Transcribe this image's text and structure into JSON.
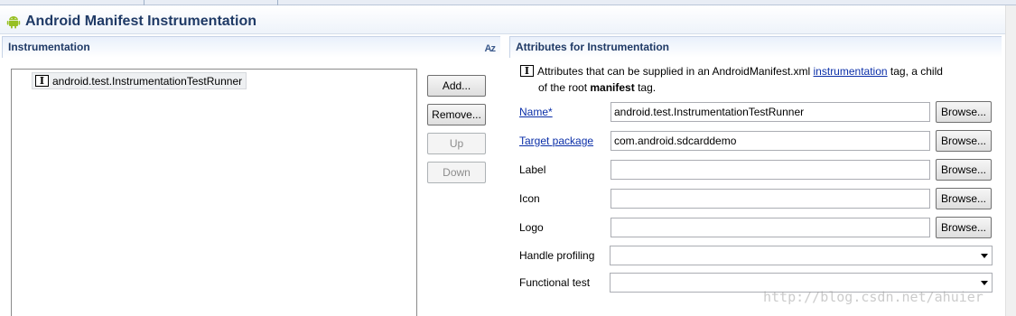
{
  "editor": {
    "title": "Android Manifest Instrumentation",
    "icon": "android-icon"
  },
  "left_section": {
    "title": "Instrumentation",
    "sort_icon": "Az",
    "tree_items": [
      {
        "icon": "I",
        "label": "android.test.InstrumentationTestRunner"
      }
    ],
    "buttons": {
      "add": "Add...",
      "remove": "Remove...",
      "up": "Up",
      "down": "Down"
    }
  },
  "right_section": {
    "title": "Attributes for Instrumentation",
    "info": {
      "icon": "I",
      "part1": "Attributes that can be supplied in an AndroidManifest.xml ",
      "link": "instrumentation",
      "part2": " tag, a child",
      "part3": "of the root ",
      "bold": "manifest",
      "part4": " tag."
    },
    "fields": {
      "name": {
        "label": "Name*",
        "value": "android.test.InstrumentationTestRunner"
      },
      "target_package": {
        "label": "Target package",
        "value": "com.android.sdcarddemo"
      },
      "label": {
        "label": "Label",
        "value": ""
      },
      "icon": {
        "label": "Icon",
        "value": ""
      },
      "logo": {
        "label": "Logo",
        "value": ""
      },
      "handle_profiling": {
        "label": "Handle profiling",
        "value": ""
      },
      "functional_test": {
        "label": "Functional test",
        "value": ""
      }
    },
    "browse_label": "Browse..."
  },
  "watermark": "http://blog.csdn.net/ahuier",
  "colors": {
    "header_text": "#1f3a66",
    "link": "#0b2fa8",
    "android_green": "#97c024"
  }
}
